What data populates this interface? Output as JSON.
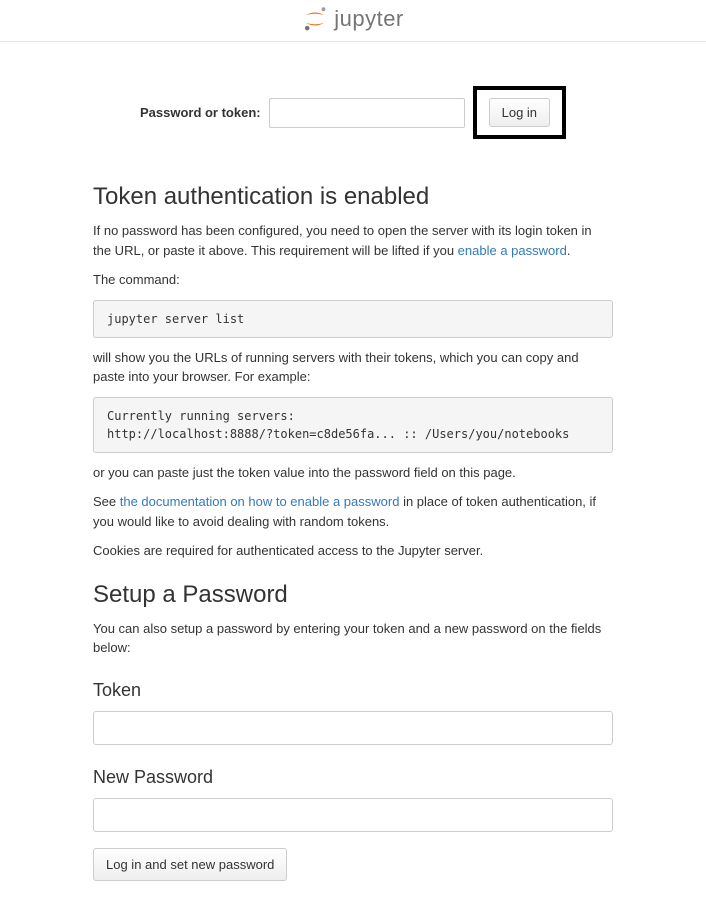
{
  "header": {
    "brand": "jupyter"
  },
  "login": {
    "label": "Password or token:",
    "button": "Log in"
  },
  "section1": {
    "heading": "Token authentication is enabled",
    "p1_before": "If no password has been configured, you need to open the server with its login token in the URL, or paste it above. This requirement will be lifted if you ",
    "p1_link": "enable a password",
    "p1_after": ".",
    "p2": "The command:",
    "code1": "jupyter server list",
    "p3": "will show you the URLs of running servers with their tokens, which you can copy and paste into your browser. For example:",
    "code2": "Currently running servers:\nhttp://localhost:8888/?token=c8de56fa... :: /Users/you/notebooks",
    "p4": "or you can paste just the token value into the password field on this page.",
    "p5_before": "See ",
    "p5_link": "the documentation on how to enable a password",
    "p5_after": " in place of token authentication, if you would like to avoid dealing with random tokens.",
    "p6": "Cookies are required for authenticated access to the Jupyter server."
  },
  "section2": {
    "heading": "Setup a Password",
    "p1": "You can also setup a password by entering your token and a new password on the fields below:",
    "token_label": "Token",
    "password_label": "New Password",
    "button": "Log in and set new password"
  }
}
